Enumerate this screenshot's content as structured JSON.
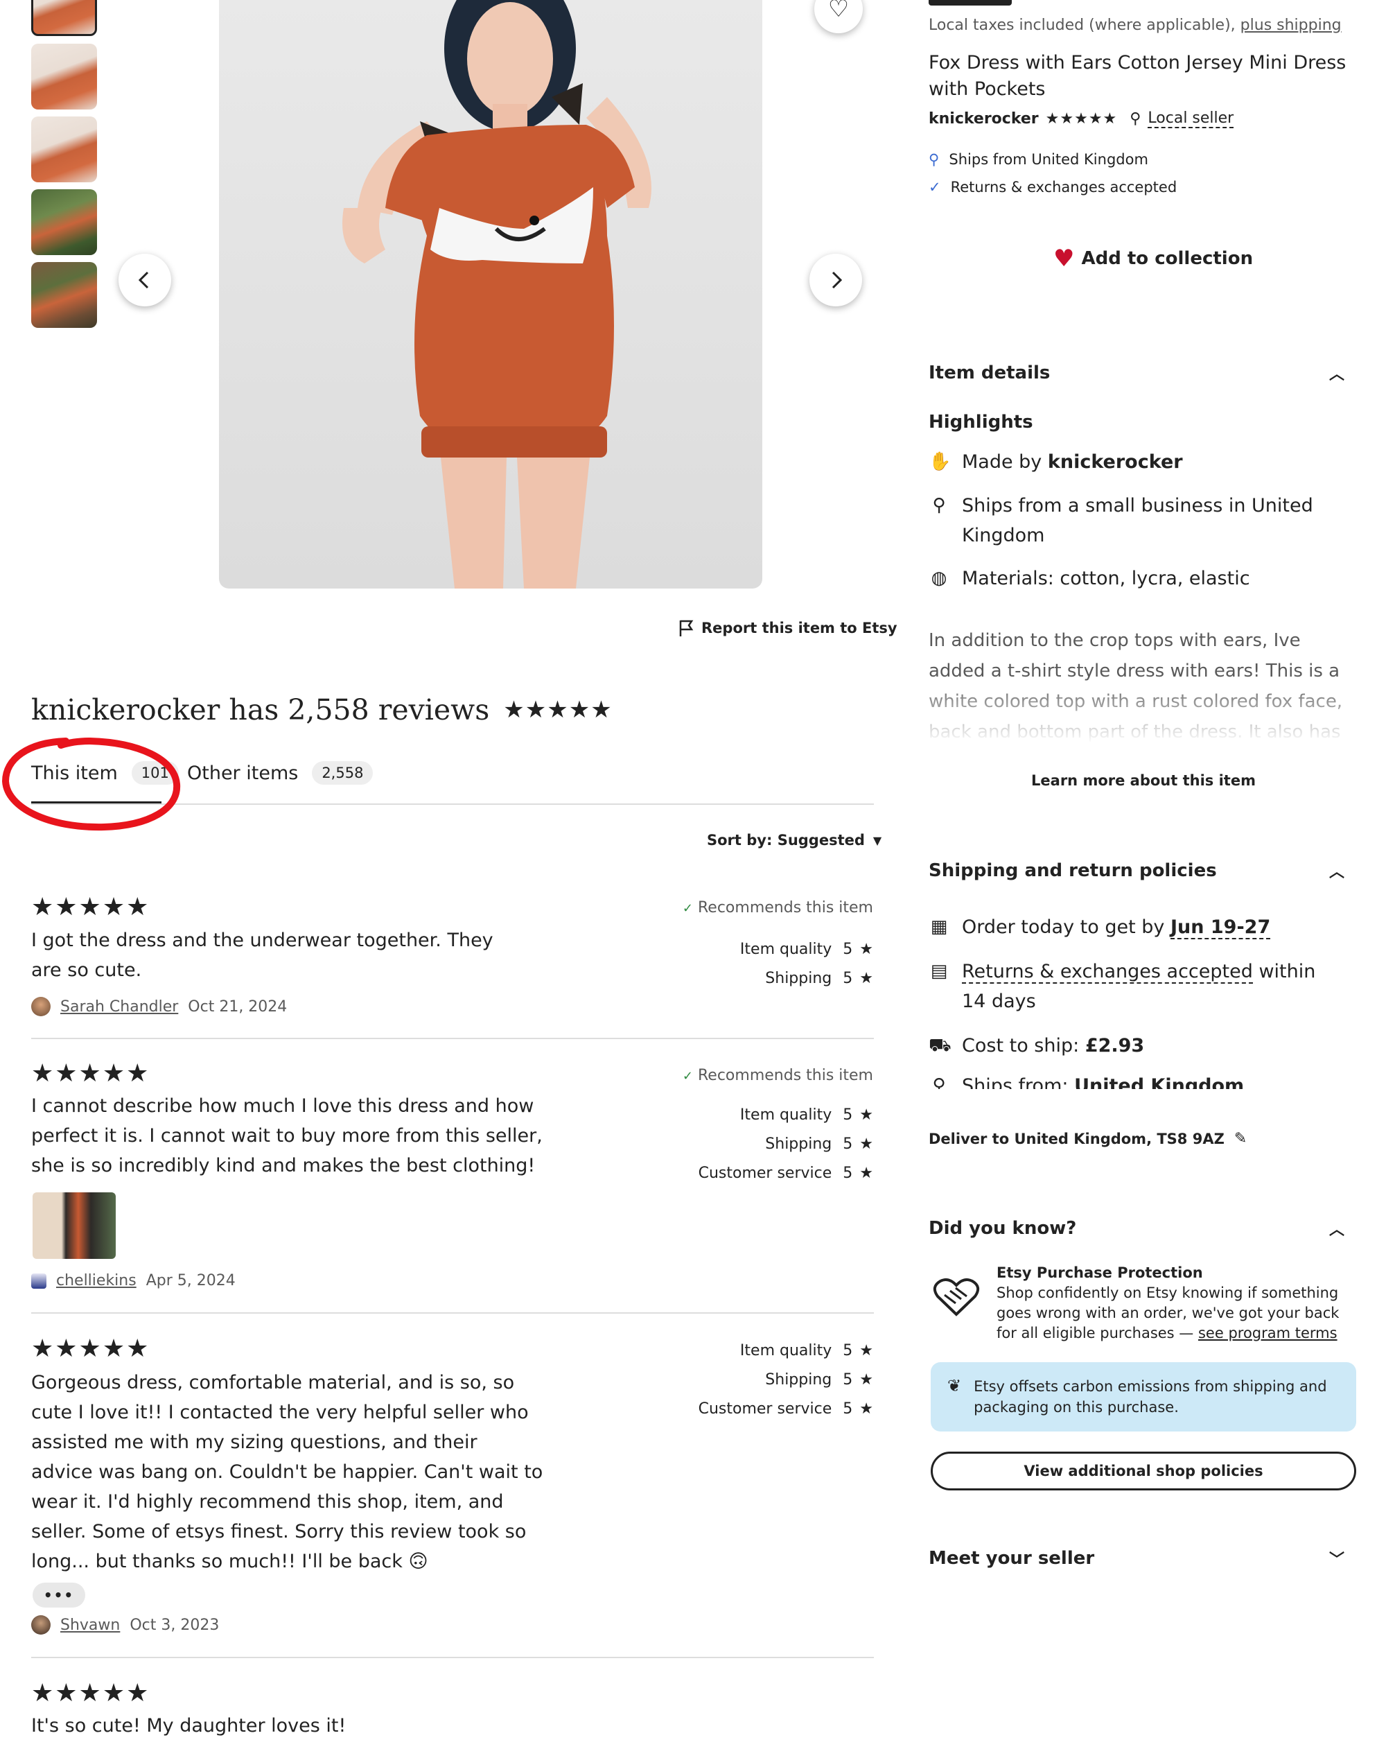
{
  "gallery": {
    "thumbnails": [
      "thumb-1",
      "thumb-2",
      "thumb-3",
      "thumb-4",
      "thumb-5"
    ],
    "report_label": "Report this item to Etsy"
  },
  "product": {
    "taxes_note": "Local taxes included (where applicable),",
    "shipping_link": "plus shipping",
    "title": "Fox Dress with Ears Cotton Jersey Mini Dress with Pockets",
    "shop_name": "knickerocker",
    "shop_stars": "★★★★★",
    "local_seller": "Local seller",
    "ships_from": "Ships from United Kingdom",
    "returns": "Returns & exchanges accepted",
    "add_to_collection": "Add to collection"
  },
  "item_details": {
    "heading": "Item details",
    "highlights_heading": "Highlights",
    "made_by_prefix": "Made by",
    "made_by_shop": "knickerocker",
    "ships_small_business": "Ships from a small business in United Kingdom",
    "materials": "Materials: cotton, lycra, elastic",
    "description": "In addition to the crop tops with ears, Ive added a t-shirt style dress with ears! This is a white colored top with a rust colored fox face, back and bottom part of the dress. It also has fox ears",
    "learn_more": "Learn more about this item"
  },
  "shipping": {
    "heading": "Shipping and return policies",
    "order_prefix": "Order today to get by",
    "order_date": "Jun 19-27",
    "returns_link": "Returns & exchanges accepted",
    "returns_suffix": "within 14 days",
    "cost_prefix": "Cost to ship:",
    "cost_value": "£2.93",
    "ships_from_prefix": "Ships from:",
    "ships_from_value": "United Kingdom",
    "deliver_to": "Deliver to United Kingdom, TS8 9AZ"
  },
  "did_you_know": {
    "heading": "Did you know?",
    "protection_title": "Etsy Purchase Protection",
    "protection_text": "Shop confidently on Etsy knowing if something goes wrong with an order, we've got your back for all eligible purchases —",
    "program_terms": "see program terms",
    "carbon_text": "Etsy offsets carbon emissions from shipping and packaging on this purchase.",
    "view_policies": "View additional shop policies"
  },
  "meet_seller": {
    "heading": "Meet your seller"
  },
  "reviews": {
    "heading": "knickerocker has 2,558 reviews",
    "heading_stars": "★★★★★",
    "tabs": [
      {
        "label": "This item",
        "count": "101"
      },
      {
        "label": "Other items",
        "count": "2,558"
      }
    ],
    "sort_label": "Sort by: Suggested",
    "items": [
      {
        "stars": "★★★★★",
        "recommends": "Recommends this item",
        "text": "I got the dress and the underwear together. They are so cute.",
        "ratings": [
          {
            "label": "Item quality",
            "value": "5"
          },
          {
            "label": "Shipping",
            "value": "5"
          }
        ],
        "author": "Sarah Chandler",
        "date": "Oct 21, 2024"
      },
      {
        "stars": "★★★★★",
        "recommends": "Recommends this item",
        "text": "I cannot describe how much I love this dress and how perfect it is. I cannot wait to buy more from this seller, she is so incredibly kind and makes the best clothing!",
        "ratings": [
          {
            "label": "Item quality",
            "value": "5"
          },
          {
            "label": "Shipping",
            "value": "5"
          },
          {
            "label": "Customer service",
            "value": "5"
          }
        ],
        "author": "chelliekins",
        "date": "Apr 5, 2024"
      },
      {
        "stars": "★★★★★",
        "text": "Gorgeous dress, comfortable material, and is so, so cute I love it!! I contacted the very helpful seller who assisted me with my sizing questions, and their advice was bang on. Couldn't be happier. Can't wait to wear it. I'd highly recommend this shop, item, and seller. Some of etsys finest. Sorry this review took so long... but thanks so much!! I'll be back 🙃",
        "ratings": [
          {
            "label": "Item quality",
            "value": "5"
          },
          {
            "label": "Shipping",
            "value": "5"
          },
          {
            "label": "Customer service",
            "value": "5"
          }
        ],
        "more": "•••",
        "author": "Shvawn",
        "date": "Oct 3, 2023"
      },
      {
        "stars": "★★★★★",
        "text": "It's so cute! My daughter loves it!"
      }
    ]
  },
  "colors": {
    "annotation_circle": "#e8141c",
    "heart": "#c8102e",
    "carbon_bg": "#cde9f7",
    "dress": "#c85a32"
  }
}
